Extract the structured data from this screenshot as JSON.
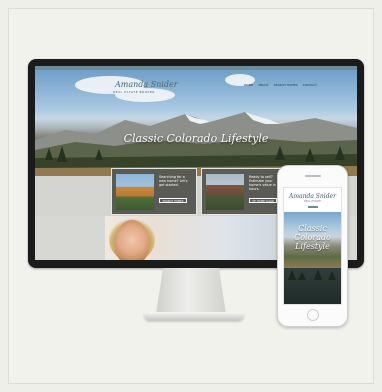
{
  "desktop_site": {
    "topbar_text": "",
    "logo_script": "Amanda Snider",
    "logo_sub": "REAL ESTATE BROKER",
    "nav": [
      "HOME",
      "ABOUT",
      "SEARCH HOMES",
      "CONTACT"
    ],
    "hero_title": "Classic Colorado Lifestyle",
    "hero_text": "",
    "cards": [
      {
        "text": "Searching for a new home? Let's get started.",
        "button": "SEARCH HOMES"
      },
      {
        "text": "Ready to sell? Estimate your home's value in hours.",
        "button": "MY HOME VALUE"
      }
    ]
  },
  "phone_site": {
    "logo_script": "Amanda Snider",
    "logo_sub": "REAL ESTATE",
    "hero_title": "Classic Colorado Lifestyle",
    "hero_text": ""
  },
  "colors": {
    "background": "#efefea",
    "accent": "#6e8c96"
  }
}
